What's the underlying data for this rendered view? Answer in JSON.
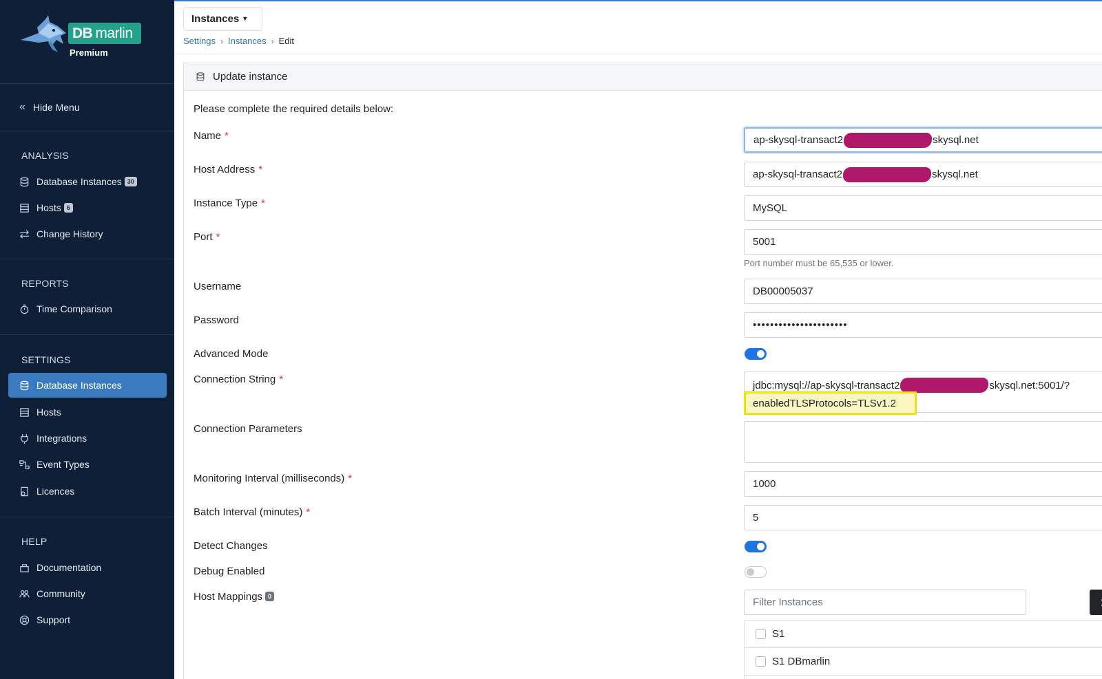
{
  "brand": {
    "db": "DB",
    "marlin": "marlin",
    "tier": "Premium"
  },
  "sidebar": {
    "hide_menu": "Hide Menu",
    "analysis": {
      "title": "ANALYSIS",
      "items": [
        {
          "label": "Database Instances",
          "badge": "30",
          "icon": "database-icon"
        },
        {
          "label": "Hosts",
          "badge": "6",
          "icon": "server-icon"
        },
        {
          "label": "Change History",
          "icon": "arrows-swap-icon"
        }
      ]
    },
    "reports": {
      "title": "REPORTS",
      "items": [
        {
          "label": "Time Comparison",
          "icon": "stopwatch-icon"
        }
      ]
    },
    "settings": {
      "title": "SETTINGS",
      "items": [
        {
          "label": "Database Instances",
          "icon": "database-icon",
          "active": true
        },
        {
          "label": "Hosts",
          "icon": "server-icon"
        },
        {
          "label": "Integrations",
          "icon": "plug-icon"
        },
        {
          "label": "Event Types",
          "icon": "diagram-icon"
        },
        {
          "label": "Licences",
          "icon": "certificate-icon"
        }
      ]
    },
    "help": {
      "title": "HELP",
      "items": [
        {
          "label": "Documentation",
          "icon": "docs-icon"
        },
        {
          "label": "Community",
          "icon": "people-icon"
        },
        {
          "label": "Support",
          "icon": "lifebuoy-icon"
        }
      ]
    }
  },
  "header": {
    "dropdown_label": "Instances",
    "breadcrumb": {
      "settings": "Settings",
      "instances": "Instances",
      "current": "Edit"
    }
  },
  "card": {
    "title": "Update instance",
    "intro": "Please complete the required details below:"
  },
  "form": {
    "name": {
      "label": "Name",
      "value_prefix": "ap-skysql-transact2",
      "value_suffix": "skysql.net"
    },
    "host": {
      "label": "Host Address",
      "value_prefix": "ap-skysql-transact2",
      "value_suffix": "skysql.net"
    },
    "instance_type": {
      "label": "Instance Type",
      "value": "MySQL"
    },
    "port": {
      "label": "Port",
      "value": "5001",
      "help": "Port number must be 65,535 or lower."
    },
    "username": {
      "label": "Username",
      "value": "DB00005037"
    },
    "password": {
      "label": "Password",
      "value": "••••••••••••••••••••••"
    },
    "advanced_mode": {
      "label": "Advanced Mode",
      "on": true
    },
    "connection_string": {
      "label": "Connection String",
      "line1_prefix": "jdbc:mysql://ap-skysql-transact2",
      "line1_suffix": "skysql.net:5001/?",
      "line2": "enabledTLSProtocols=TLSv1.2"
    },
    "connection_params": {
      "label": "Connection Parameters",
      "value": ""
    },
    "monitoring_interval": {
      "label": "Monitoring Interval (milliseconds)",
      "value": "1000"
    },
    "batch_interval": {
      "label": "Batch Interval (minutes)",
      "value": "5"
    },
    "detect_changes": {
      "label": "Detect Changes",
      "on": true
    },
    "debug_enabled": {
      "label": "Debug Enabled",
      "on": false
    },
    "host_mappings": {
      "label": "Host Mappings",
      "badge": "0",
      "filter_placeholder": "Filter Instances",
      "items": [
        {
          "label": "S1"
        },
        {
          "label": "S1 DBmarlin"
        }
      ]
    }
  },
  "colors": {
    "sidebar_bg": "#0e1f37",
    "active_nav": "#3a7bbf",
    "link": "#2a78c2",
    "toggle_on": "#1e74e0",
    "required": "#dc3545",
    "highlight": "#f2e20c",
    "redaction": "#b0196b",
    "logo_badge": "#23a18a"
  }
}
